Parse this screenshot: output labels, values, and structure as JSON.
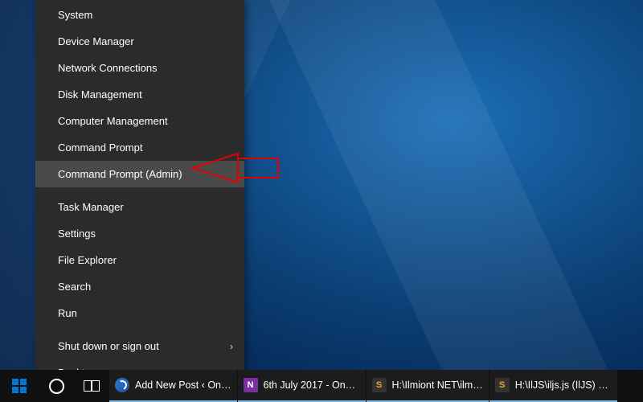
{
  "winx": {
    "groups": [
      {
        "items": [
          {
            "label": "System",
            "name": "winx-system"
          },
          {
            "label": "Device Manager",
            "name": "winx-device-manager"
          },
          {
            "label": "Network Connections",
            "name": "winx-network-connections"
          },
          {
            "label": "Disk Management",
            "name": "winx-disk-management"
          },
          {
            "label": "Computer Management",
            "name": "winx-computer-management"
          },
          {
            "label": "Command Prompt",
            "name": "winx-command-prompt"
          },
          {
            "label": "Command Prompt (Admin)",
            "name": "winx-command-prompt-admin",
            "hover": true
          }
        ]
      },
      {
        "items": [
          {
            "label": "Task Manager",
            "name": "winx-task-manager"
          },
          {
            "label": "Settings",
            "name": "winx-settings"
          },
          {
            "label": "File Explorer",
            "name": "winx-file-explorer"
          },
          {
            "label": "Search",
            "name": "winx-search"
          },
          {
            "label": "Run",
            "name": "winx-run"
          }
        ]
      },
      {
        "items": [
          {
            "label": "Shut down or sign out",
            "name": "winx-shutdown",
            "submenu": true
          },
          {
            "label": "Desktop",
            "name": "winx-desktop"
          }
        ]
      }
    ]
  },
  "taskbar": {
    "apps": [
      {
        "label": "Add New Post ‹ On…",
        "name": "taskbar-edge",
        "icon": "edge"
      },
      {
        "label": "6th July 2017 - One…",
        "name": "taskbar-onenote",
        "icon": "onenote"
      },
      {
        "label": "H:\\Ilmiont NET\\ilm…",
        "name": "taskbar-sublime-1",
        "icon": "sublime"
      },
      {
        "label": "H:\\IlJS\\iljs.js (IlJS) - …",
        "name": "taskbar-sublime-2",
        "icon": "sublime"
      }
    ]
  }
}
